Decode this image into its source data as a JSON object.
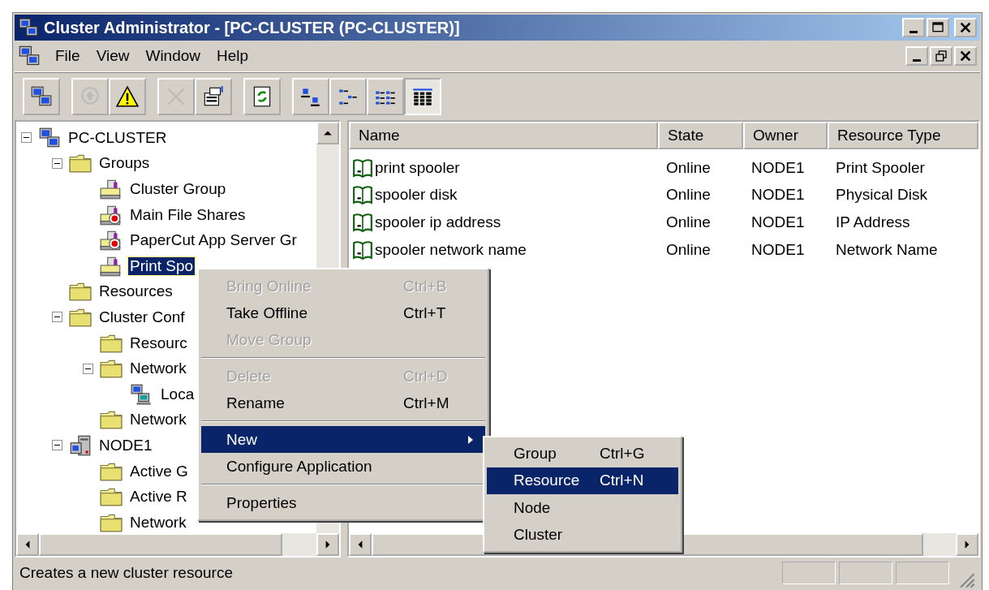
{
  "window": {
    "title": "Cluster Administrator - [PC-CLUSTER (PC-CLUSTER)]"
  },
  "menu_bar": [
    "File",
    "View",
    "Window",
    "Help"
  ],
  "toolbar": [
    {
      "kind": "cluster",
      "disabled": false,
      "pressed": false
    },
    {
      "kind": "separator"
    },
    {
      "kind": "bring-online",
      "disabled": true,
      "pressed": false
    },
    {
      "kind": "warning",
      "disabled": false,
      "pressed": false
    },
    {
      "kind": "separator"
    },
    {
      "kind": "delete",
      "disabled": true,
      "pressed": false
    },
    {
      "kind": "properties",
      "disabled": false,
      "pressed": false
    },
    {
      "kind": "separator"
    },
    {
      "kind": "refresh",
      "disabled": false,
      "pressed": false
    },
    {
      "kind": "separator"
    },
    {
      "kind": "large-icons",
      "disabled": false,
      "pressed": false
    },
    {
      "kind": "small-icons",
      "disabled": false,
      "pressed": false
    },
    {
      "kind": "list",
      "disabled": false,
      "pressed": false
    },
    {
      "kind": "details",
      "disabled": false,
      "pressed": true
    }
  ],
  "tree": [
    {
      "label": "PC-CLUSTER",
      "kind": "cluster",
      "expanded": true,
      "selected": false,
      "children": [
        {
          "label": "Groups",
          "kind": "folder",
          "expanded": true,
          "selected": false,
          "children": [
            {
              "label": "Cluster Group",
              "kind": "group",
              "selected": false
            },
            {
              "label": "Main File Shares",
              "kind": "group-failed",
              "selected": false
            },
            {
              "label": "PaperCut App Server Gr",
              "kind": "group-failed",
              "selected": false
            },
            {
              "label": "Print Spo",
              "kind": "group",
              "selected": true
            }
          ]
        },
        {
          "label": "Resources",
          "kind": "folder",
          "selected": false
        },
        {
          "label": "Cluster Conf",
          "kind": "folder",
          "expanded": true,
          "selected": false,
          "children": [
            {
              "label": "Resourc",
              "kind": "folder",
              "selected": false
            },
            {
              "label": "Network",
              "kind": "folder",
              "expanded": true,
              "selected": false,
              "children": [
                {
                  "label": "Loca",
                  "kind": "network",
                  "selected": false
                }
              ]
            },
            {
              "label": "Network",
              "kind": "folder",
              "selected": false
            }
          ]
        },
        {
          "label": "NODE1",
          "kind": "node",
          "expanded": true,
          "selected": false,
          "children": [
            {
              "label": "Active G",
              "kind": "folder",
              "selected": false
            },
            {
              "label": "Active R",
              "kind": "folder",
              "selected": false
            },
            {
              "label": "Network",
              "kind": "folder",
              "selected": false
            }
          ]
        }
      ]
    }
  ],
  "resources": {
    "columns": [
      "Name",
      "State",
      "Owner",
      "Resource Type"
    ],
    "rows": [
      [
        "print spooler",
        "Online",
        "NODE1",
        "Print Spooler"
      ],
      [
        "spooler disk",
        "Online",
        "NODE1",
        "Physical Disk"
      ],
      [
        "spooler ip address",
        "Online",
        "NODE1",
        "IP Address"
      ],
      [
        "spooler network name",
        "Online",
        "NODE1",
        "Network Name"
      ]
    ]
  },
  "context_menu": {
    "items": [
      {
        "kind": "item",
        "label": "Bring Online",
        "shortcut": "Ctrl+B",
        "disabled": true,
        "selected": false,
        "submenu": false
      },
      {
        "kind": "item",
        "label": "Take Offline",
        "shortcut": "Ctrl+T",
        "disabled": false,
        "selected": false,
        "submenu": false
      },
      {
        "kind": "item",
        "label": "Move Group",
        "disabled": true,
        "selected": false,
        "submenu": false
      },
      {
        "kind": "separator"
      },
      {
        "kind": "item",
        "label": "Delete",
        "shortcut": "Ctrl+D",
        "disabled": true,
        "selected": false,
        "submenu": false
      },
      {
        "kind": "item",
        "label": "Rename",
        "shortcut": "Ctrl+M",
        "disabled": false,
        "selected": false,
        "submenu": false
      },
      {
        "kind": "separator"
      },
      {
        "kind": "item",
        "label": "New",
        "disabled": false,
        "selected": true,
        "submenu": true
      },
      {
        "kind": "item",
        "label": "Configure Application",
        "disabled": false,
        "selected": false,
        "submenu": false
      },
      {
        "kind": "separator"
      },
      {
        "kind": "item",
        "label": "Properties",
        "disabled": false,
        "selected": false,
        "submenu": false
      }
    ]
  },
  "submenu": {
    "items": [
      {
        "label": "Group",
        "shortcut": "Ctrl+G",
        "selected": false
      },
      {
        "label": "Resource",
        "shortcut": "Ctrl+N",
        "selected": true
      },
      {
        "label": "Node",
        "selected": false
      },
      {
        "label": "Cluster",
        "selected": false
      }
    ]
  },
  "status_bar": {
    "text": "Creates a new cluster resource"
  }
}
